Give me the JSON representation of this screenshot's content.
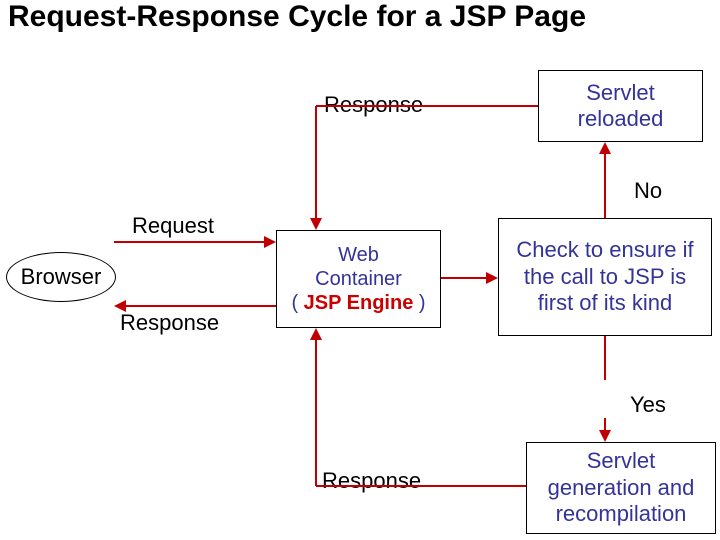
{
  "title": "Request-Response Cycle for  a JSP Page",
  "browser": "Browser",
  "labels": {
    "request": "Request",
    "response_browser": "Response",
    "response_top": "Response",
    "response_bottom": "Response",
    "no": "No",
    "yes": "Yes"
  },
  "boxes": {
    "servlet_reloaded": "Servlet reloaded",
    "web_top": "Web",
    "web_mid": "Container",
    "web_paren_open": "( ",
    "web_engine": "JSP Engine",
    "web_paren_close": " )",
    "check": "Check to ensure if the call to JSP is first of its kind",
    "servlet_gen": "Servlet generation and recompilation"
  }
}
